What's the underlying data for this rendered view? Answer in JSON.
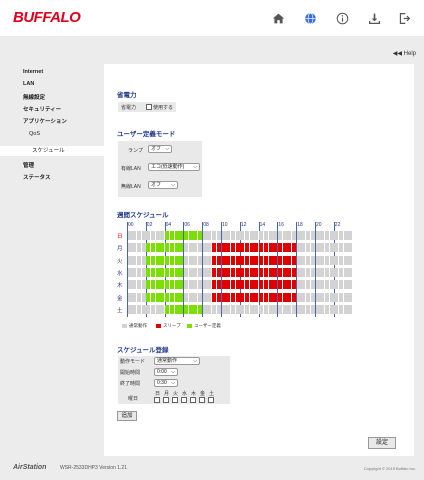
{
  "brand": {
    "logo": "BUFFALO"
  },
  "header_icons": [
    "home-icon",
    "globe-icon",
    "info-icon",
    "download-icon",
    "logout-icon"
  ],
  "help": "◀◀ Help",
  "sidebar": {
    "items": [
      {
        "label": "Internet"
      },
      {
        "label": "LAN"
      },
      {
        "label": "無線設定"
      },
      {
        "label": "セキュリティー"
      },
      {
        "label": "アプリケーション"
      },
      {
        "label": "QoS"
      },
      {
        "label": "スケジュール"
      },
      {
        "label": "管理"
      },
      {
        "label": "ステータス"
      }
    ]
  },
  "power": {
    "heading": "省電力",
    "label": "省電力",
    "checkbox_label": "使用する"
  },
  "user_mode": {
    "heading": "ユーザー定義モード",
    "lamp_label": "ランプ",
    "lamp_value": "オフ",
    "wired_label": "有線LAN",
    "wired_value": "エコ(低速動作)",
    "wireless_label": "無線LAN",
    "wireless_value": "オフ"
  },
  "weekly": {
    "heading": "週間スケジュール",
    "hours": [
      "00",
      "02",
      "04",
      "06",
      "08",
      "10",
      "12",
      "14",
      "16",
      "18",
      "20",
      "22"
    ],
    "days": [
      "日",
      "月",
      "火",
      "水",
      "木",
      "金",
      "土"
    ],
    "day_states": [
      "gggggggggggggggggggggggggggggggggggggggggggggggg",
      "GGGGGGGGGGGGGGGGGgggggggggrrrrrrrrrrrrrrrrrrrrrrrrgggggggggggggggggggggggggggggg",
      "",
      "",
      "",
      "",
      ""
    ],
    "legend": [
      {
        "label": "通常動作",
        "color": "#d3d3d3"
      },
      {
        "label": "スリープ",
        "color": "#e00000"
      },
      {
        "label": "ユーザー定義",
        "color": "#7be000"
      }
    ]
  },
  "register": {
    "heading": "スケジュール登録",
    "mode_label": "動作モード",
    "mode_value": "通常動作",
    "start_label": "開始時間",
    "start_value": "0:00",
    "end_label": "終了時間",
    "end_value": "0:30",
    "dow_label": "曜日",
    "dow_days": [
      "日",
      "月",
      "火",
      "水",
      "木",
      "金",
      "土"
    ],
    "add_button": "追加"
  },
  "apply_button": "設定",
  "footer": {
    "product": "AirStation",
    "model": "WSR-2533DHP3  Version 1.21",
    "copyright": "Copyright © 2019 Buffalo Inc."
  },
  "colors": {
    "accent_red": "#e0001b",
    "heading_blue": "#223a8a",
    "sleep": "#e00000",
    "user": "#7be000",
    "normal": "#d3d3d3"
  }
}
